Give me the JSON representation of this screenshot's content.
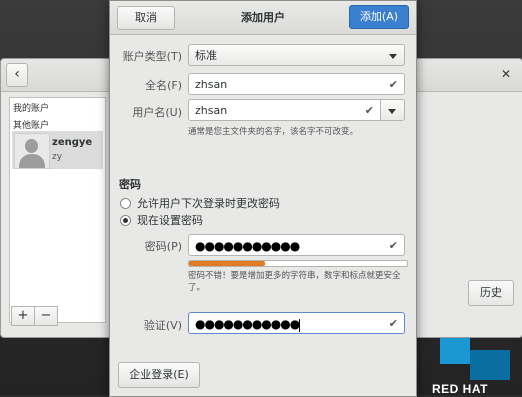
{
  "desktop": {
    "brand": "RED HAT"
  },
  "background_window": {
    "my_account_label": "我的账户",
    "other_accounts_label": "其他账户",
    "account": {
      "name": "zengye",
      "username": "zy"
    },
    "add_label": "+",
    "remove_label": "−",
    "history_label": "历史"
  },
  "dialog": {
    "title": "添加用户",
    "cancel_label": "取消",
    "add_label": "添加(A)",
    "account_type_label": "账户类型(T)",
    "account_type_value": "标准",
    "full_name_label": "全名(F)",
    "full_name_value": "zhsan",
    "username_label": "用户名(U)",
    "username_value": "zhsan",
    "username_hint": "通常是您主文件夹的名字，该名字不可改变。",
    "password_section": "密码",
    "option_later": "允许用户下次登录时更改密码",
    "option_now": "现在设置密码",
    "password_label": "密码(P)",
    "password_value": "●●●●●●●●●●●",
    "password_strength": 0.35,
    "strength_color": "#e07b24",
    "strength_hint_line1": "密码不错！要是增加更多的字符串，数字和标点就更安全",
    "strength_hint_line2": "了。",
    "verify_label": "验证(V)",
    "verify_value": "●●●●●●●●●●●",
    "enterprise_label": "企业登录(E)",
    "accent": "#3a7fd0"
  }
}
